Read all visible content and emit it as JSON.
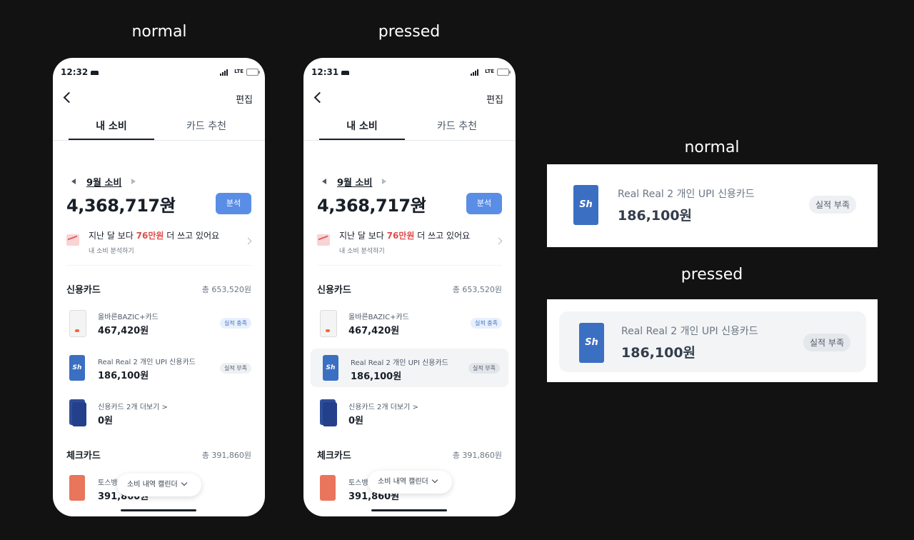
{
  "captions": {
    "normal_top": "normal",
    "pressed_top": "pressed",
    "normal_zoom": "normal",
    "pressed_zoom": "pressed"
  },
  "phone_normal": {
    "time": "12:32",
    "lte": "LTE",
    "edit": "편집",
    "tabs": [
      "내 소비",
      "카드 추천"
    ],
    "month": "9월 소비",
    "total": "4,368,717원",
    "analyze": "분석",
    "insight_pre": "지난 달 보다 ",
    "insight_highlight": "76만원",
    "insight_post": " 더 쓰고 있어요",
    "insight_sub": "내 소비 분석하기",
    "credit_title": "신용카드",
    "credit_total": "총 653,520원",
    "credit_cards": [
      {
        "name": "올바른BAZIC+카드",
        "amount": "467,420원",
        "badge": "실적 충족"
      },
      {
        "name": "Real Real 2 개인 UPI 신용카드",
        "amount": "186,100원",
        "badge": "실적 부족",
        "logo": "Sh"
      },
      {
        "name": "신용카드 2개 더보기 >",
        "amount": "0원"
      }
    ],
    "check_title": "체크카드",
    "check_total": "총 391,860원",
    "check_card": {
      "name": "토스뱅",
      "amount": "391,860원"
    },
    "calendar": "소비 내역 캘린더"
  },
  "phone_pressed": {
    "time": "12:31",
    "lte": "LTE",
    "edit": "편집",
    "tabs": [
      "내 소비",
      "카드 추천"
    ],
    "month": "9월 소비",
    "total": "4,368,717원",
    "analyze": "분석",
    "insight_pre": "지난 달 보다 ",
    "insight_highlight": "76만원",
    "insight_post": " 더 쓰고 있어요",
    "insight_sub": "내 소비 분석하기",
    "credit_title": "신용카드",
    "credit_total": "총 653,520원",
    "credit_cards": [
      {
        "name": "올바른BAZIC+카드",
        "amount": "467,420원",
        "badge": "실적 충족"
      },
      {
        "name": "Real Real 2 개인 UPI 신용카드",
        "amount": "186,100원",
        "badge": "실적 부족",
        "logo": "Sh"
      },
      {
        "name": "신용카드 2개 더보기 >",
        "amount": "0원"
      }
    ],
    "check_title": "체크카드",
    "check_total": "총 391,860원",
    "check_card": {
      "name": "토스뱅",
      "amount": "391,860원"
    },
    "calendar": "소비 내역 캘린더"
  },
  "zoom_normal": {
    "logo": "Sh",
    "name": "Real Real 2 개인 UPI 신용카드",
    "amount": "186,100원",
    "badge": "실적 부족"
  },
  "zoom_pressed": {
    "logo": "Sh",
    "name": "Real Real 2 개인 UPI 신용카드",
    "amount": "186,100원",
    "badge": "실적 부족"
  },
  "colors": {
    "background": "#121212",
    "accent": "#5a8ee6",
    "highlight": "#e04a4a",
    "pressed_bg": "#f2f4f6"
  }
}
